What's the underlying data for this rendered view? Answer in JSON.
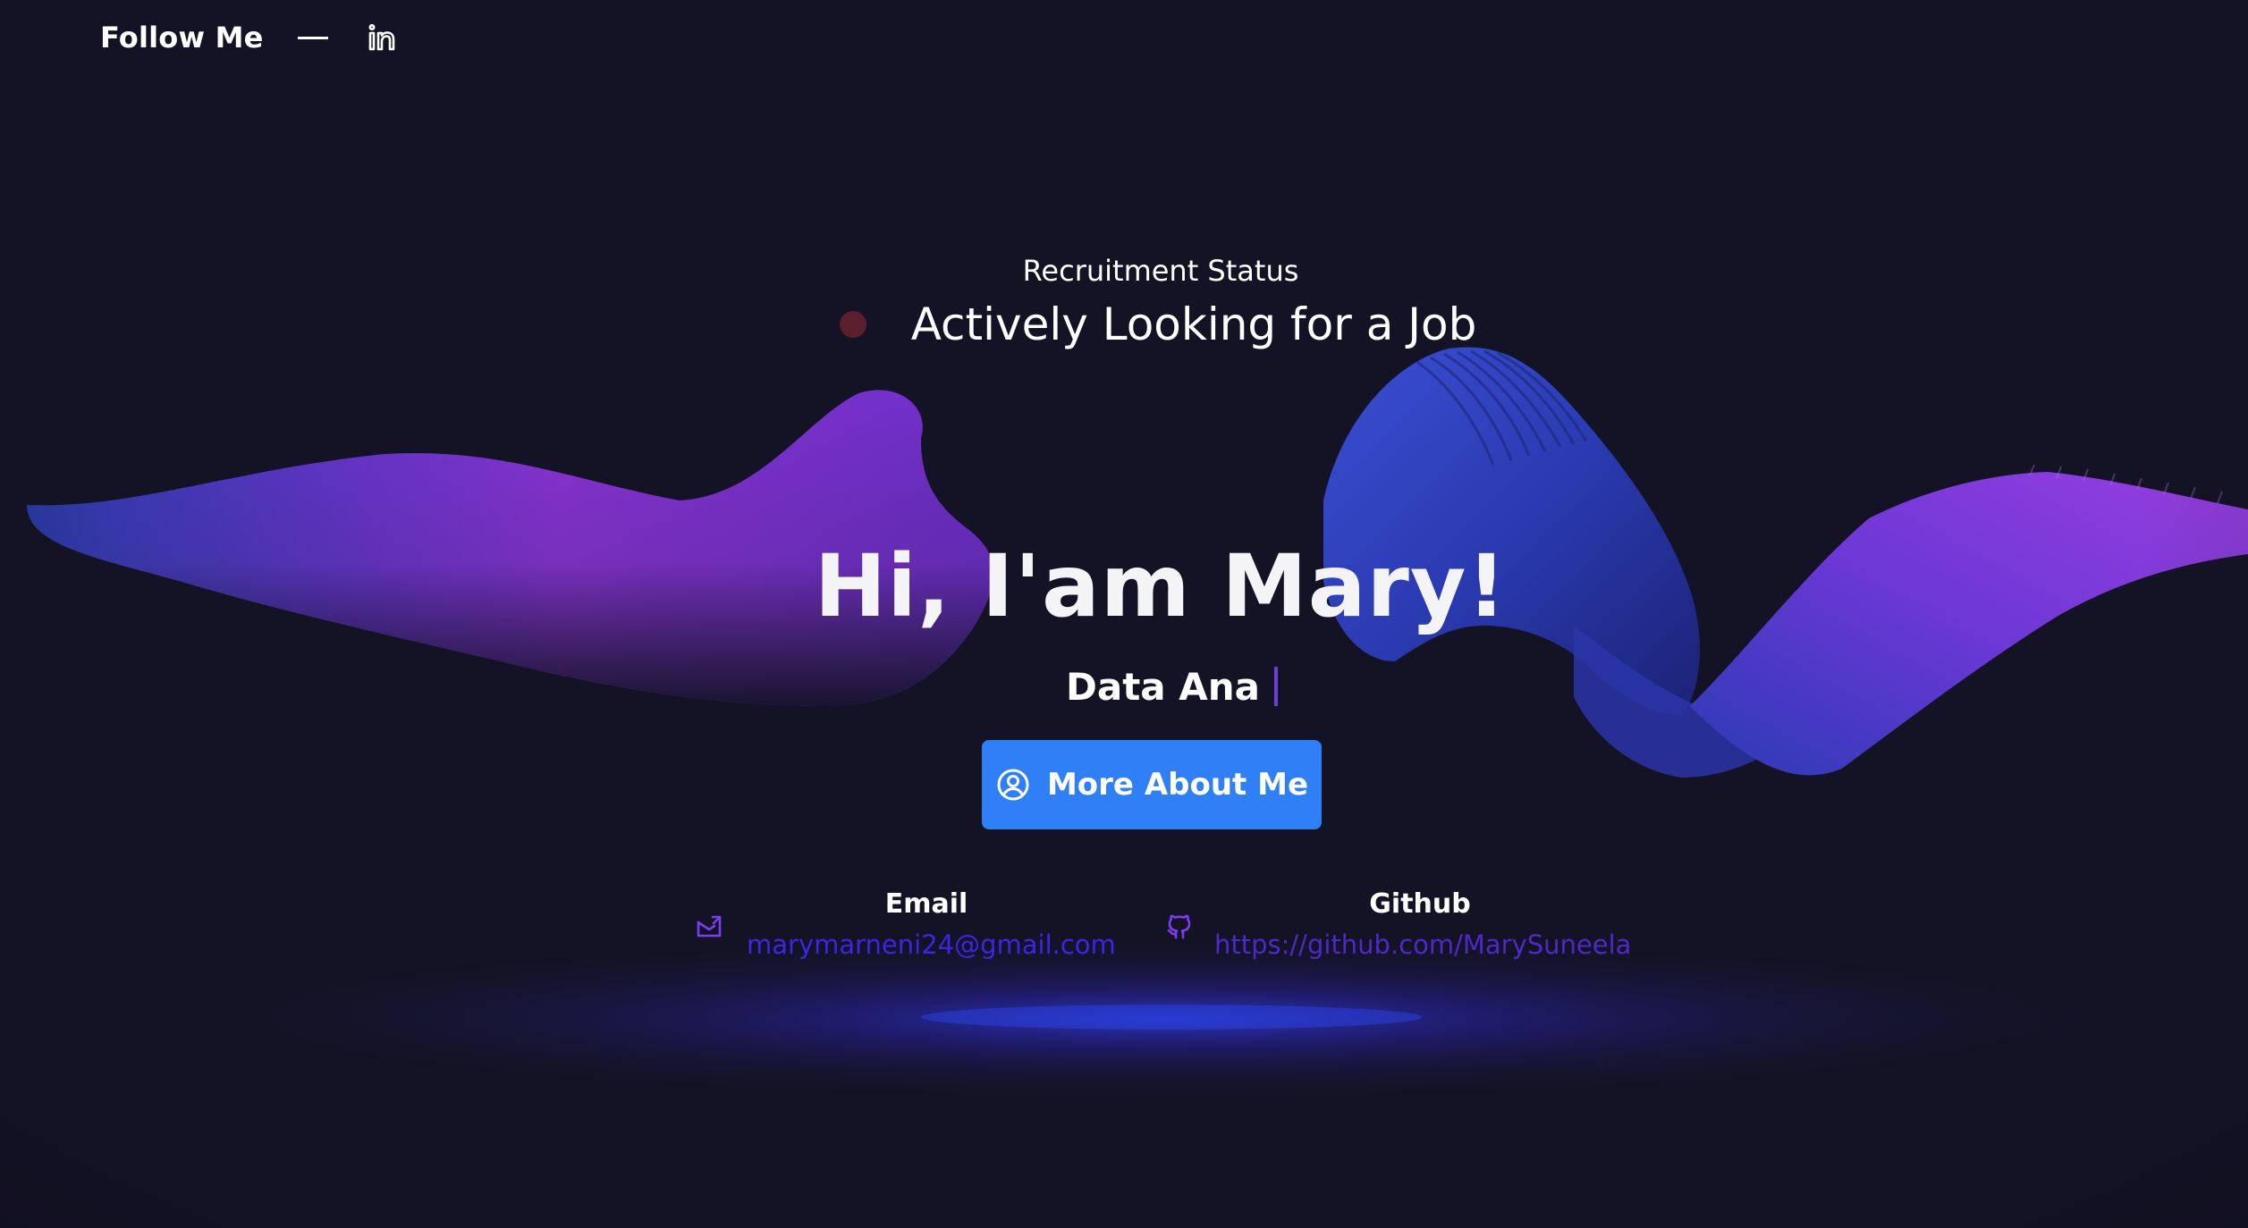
{
  "social": {
    "label": "Follow Me",
    "icon": "linkedin-icon"
  },
  "status": {
    "title": "Recruitment Status",
    "text": "Actively Looking for a Job",
    "dot_color": "#5a1e2c"
  },
  "hero": {
    "greeting": "Hi, I'am Mary!",
    "subtitle": "Data Ana",
    "button_label": "More About Me",
    "button_icon": "user-circle-icon",
    "button_color": "#2f80f6"
  },
  "contacts": {
    "email": {
      "heading": "Email",
      "value": "marymarneni24@gmail.com",
      "icon": "mail-icon"
    },
    "github": {
      "heading": "Github",
      "value": "https://github.com/MarySuneela",
      "icon": "github-icon"
    }
  },
  "colors": {
    "background": "#141326",
    "accent_blue": "#2f80f6",
    "accent_purple": "#7a38d9"
  }
}
